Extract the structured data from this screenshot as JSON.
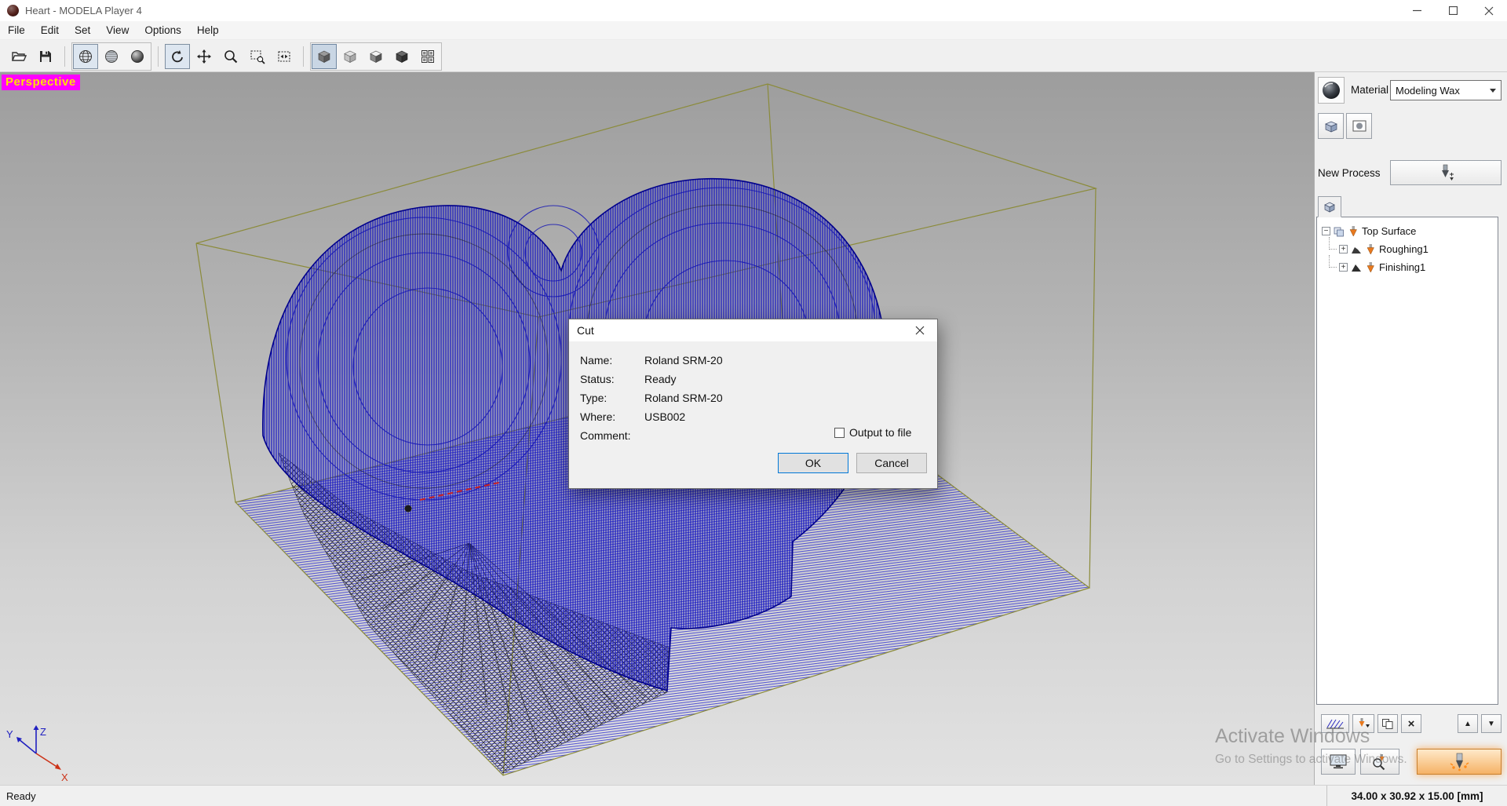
{
  "window": {
    "title": "Heart - MODELA Player 4"
  },
  "menu": {
    "items": [
      "File",
      "Edit",
      "Set",
      "View",
      "Options",
      "Help"
    ]
  },
  "toolbar": {
    "buttons": [
      "open",
      "save",
      "view-perspective",
      "view-lines",
      "view-shaded",
      "rotate",
      "pan",
      "zoom",
      "zoom-box",
      "fit-view",
      "display-solid",
      "display-light",
      "display-face",
      "display-dark",
      "multi-view"
    ]
  },
  "viewport": {
    "label": "Perspective",
    "axis": {
      "x": "X",
      "y": "Y",
      "z": "Z"
    }
  },
  "watermark": {
    "line1": "Activate Windows",
    "line2": "Go to Settings to activate Windows."
  },
  "dialog": {
    "title": "Cut",
    "fields": [
      {
        "label": "Name:",
        "value": "Roland SRM-20"
      },
      {
        "label": "Status:",
        "value": "Ready"
      },
      {
        "label": "Type:",
        "value": "Roland SRM-20"
      },
      {
        "label": "Where:",
        "value": "USB002"
      },
      {
        "label": "Comment:",
        "value": ""
      }
    ],
    "output_to_file": "Output to file",
    "ok": "OK",
    "cancel": "Cancel"
  },
  "panel": {
    "material_label": "Material",
    "material_value": "Modeling Wax",
    "new_process_label": "New Process",
    "tree": {
      "root": "Top Surface",
      "children": [
        "Roughing1",
        "Finishing1"
      ]
    }
  },
  "statusbar": {
    "left": "Ready",
    "right": "34.00 x 30.92 x 15.00 [mm]"
  },
  "colors": {
    "accent_magenta": "#ff00ff",
    "toolpath_blue": "#1a1ac8",
    "box_olive": "#8b8b3a",
    "tool_orange": "#e8791e"
  },
  "icons": {
    "collapse": "−",
    "expand": "+",
    "up": "▲",
    "down": "▼",
    "delete": "×"
  }
}
